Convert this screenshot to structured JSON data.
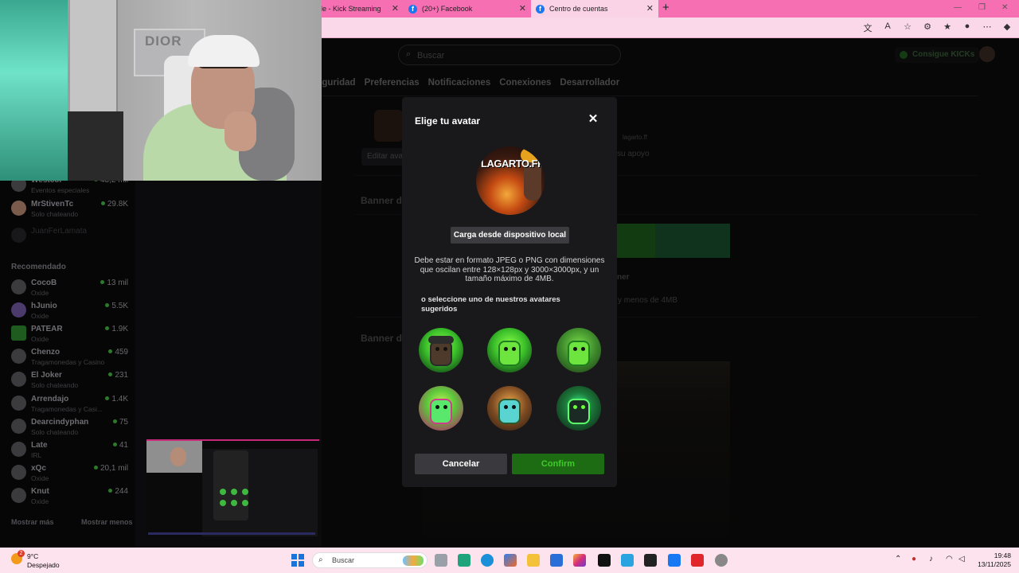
{
  "browser": {
    "tabs": [
      {
        "label": "le - Kick Streaming",
        "active": false
      },
      {
        "label": "(20+) Facebook",
        "active": false
      },
      {
        "label": "Centro de cuentas",
        "active": true
      }
    ],
    "close_glyph": "✕",
    "new_tab_glyph": "+",
    "window_controls": [
      "—",
      "❐",
      "✕"
    ],
    "toolbar_icons": [
      "translate-icon",
      "read-aloud-icon",
      "favorite-icon",
      "extensions-icon",
      "favorites-icon",
      "profile-icon",
      "more-icon",
      "copilot-icon"
    ]
  },
  "page": {
    "search_placeholder": "Buscar",
    "kicks_button": "Consigue KICKs",
    "settings_tabs": [
      "eguridad",
      "Preferencias",
      "Notificaciones",
      "Conexiones",
      "Desarrollador"
    ],
    "edit_avatar": "Editar avatar",
    "username_fragment": "lagarto.ff",
    "support_fragment": "su apoyo",
    "banner_section_1": "Banner d",
    "banner_section_2": "Banner d",
    "banner_button_fragment": "ner",
    "banner_size_fragment": "y menos de 4MB"
  },
  "sidebar": {
    "following": [
      {
        "name": "Westcol",
        "sub": "Eventos especiales",
        "count": "43,2 mil"
      },
      {
        "name": "MrStivenTc",
        "sub": "Solo chateando",
        "count": "29.8K"
      },
      {
        "name": "JuanFerLamata",
        "sub": "",
        "count": ""
      }
    ],
    "recommended_heading": "Recomendado",
    "recommended": [
      {
        "name": "CocoB",
        "sub": "Oxide",
        "count": "13 mil"
      },
      {
        "name": "hJunio",
        "sub": "Oxide",
        "count": "5.5K"
      },
      {
        "name": "PATEAR",
        "sub": "Oxide",
        "count": "1.9K"
      },
      {
        "name": "Chenzo",
        "sub": "Tragamonedas y Casino",
        "count": "459"
      },
      {
        "name": "El Joker",
        "sub": "Solo chateando",
        "count": "231"
      },
      {
        "name": "Arrendajo",
        "sub": "Tragamonedas y Casi...",
        "count": "1.4K"
      },
      {
        "name": "Dearcindyphan",
        "sub": "Solo chateando",
        "count": "75"
      },
      {
        "name": "Late",
        "sub": "IRL",
        "count": "41"
      },
      {
        "name": "xQc",
        "sub": "Oxide",
        "count": "20,1 mil"
      },
      {
        "name": "Knut",
        "sub": "Oxide",
        "count": "244"
      }
    ],
    "show_more": "Mostrar más",
    "show_less": "Mostrar menos"
  },
  "webcam": {
    "poster_text": "DIOR"
  },
  "modal": {
    "title": "Elige tu avatar",
    "close_glyph": "✕",
    "current_avatar_text": "LAGARTO.FF",
    "upload_button": "Carga desde dispositivo local",
    "hint": "Debe estar en formato JPEG o PNG con dimensiones que oscilan entre 128×128px y 3000×3000px, y un tamaño máximo de 4MB.",
    "suggested_label": "o seleccione uno de nuestros avatares sugeridos",
    "suggested_count": 6,
    "cancel": "Cancelar",
    "confirm": "Confirm"
  },
  "taskbar": {
    "weather_temp": "9°C",
    "weather_cond": "Despejado",
    "weather_badge": "2",
    "search_placeholder": "Buscar",
    "time": "19:48",
    "date": "13/11/2025",
    "apps": [
      "task-view-icon",
      "copilot-app-icon",
      "edge-icon",
      "office-icon",
      "file-explorer-icon",
      "store-icon",
      "instagram-icon",
      "netflix-icon",
      "star-app-icon",
      "amazon-icon",
      "facebook-icon",
      "youtube-icon",
      "chrome-icon"
    ],
    "tray": [
      "chevron-up-icon",
      "app-tray-icon",
      "microphone-icon",
      "wifi-icon",
      "volume-icon"
    ]
  },
  "colors": {
    "tabbar": "#f66fb3",
    "kick_green": "#3fcc2a",
    "modal_bg": "#19191b"
  }
}
